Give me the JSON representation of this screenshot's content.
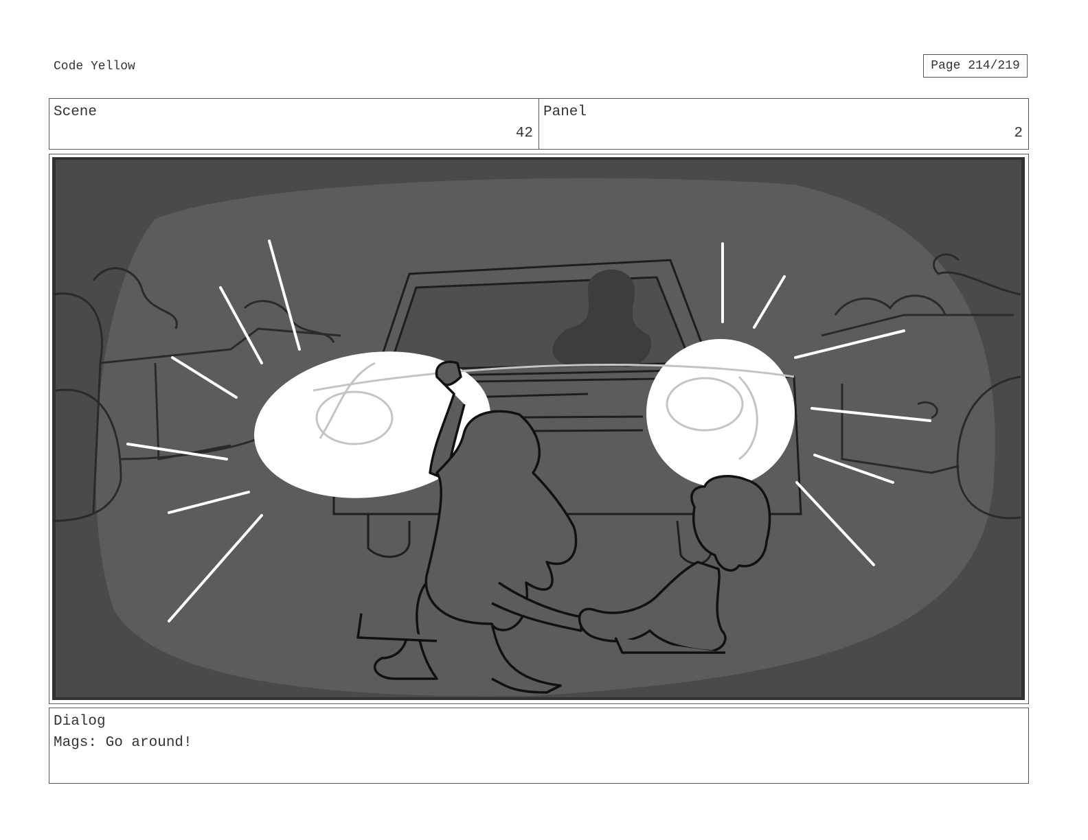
{
  "header": {
    "title": "Code Yellow",
    "page_label": "Page 214/219"
  },
  "scene": {
    "label": "Scene",
    "value": "42"
  },
  "panel": {
    "label": "Panel",
    "value": "2"
  },
  "artwork": {
    "description_icon": "storyboard-sketch",
    "colors": {
      "frame": "#333333",
      "vignette": "#4a4a4a",
      "spotlight": "#5c5c5c",
      "light": "#ffffff",
      "line": "#111111"
    }
  },
  "dialog": {
    "label": "Dialog",
    "text": "Mags: Go around!"
  }
}
